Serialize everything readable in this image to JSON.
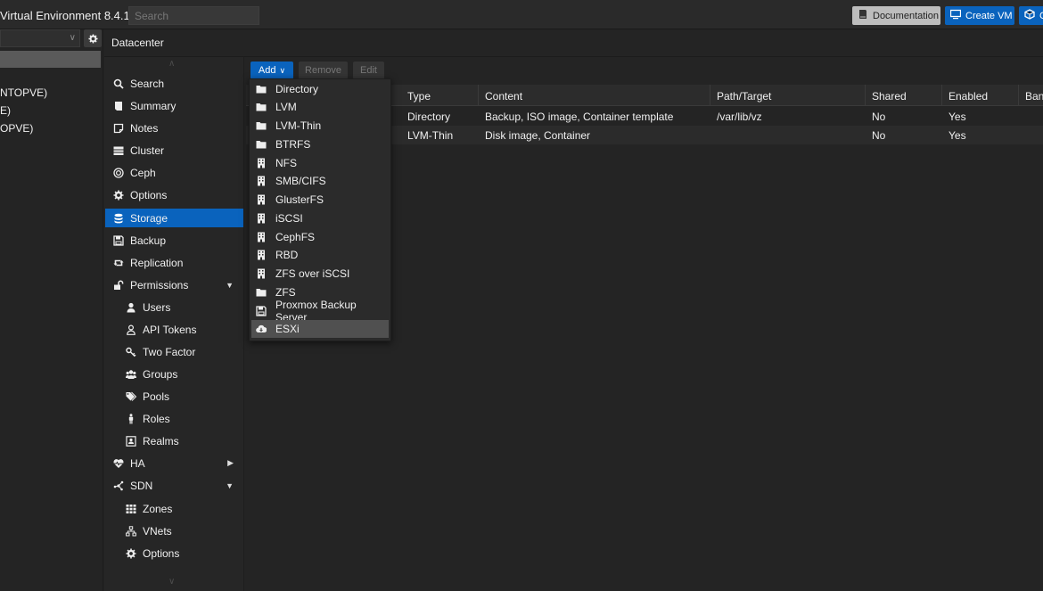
{
  "app": {
    "title": "Virtual Environment 8.4.1",
    "search_placeholder": "Search",
    "documentation_label": "Documentation",
    "create_vm_label": "Create VM",
    "create_ct_label": "C"
  },
  "tree": {
    "items": [
      "NTOPVE)",
      "E)",
      "OPVE)"
    ]
  },
  "breadcrumb": "Datacenter",
  "nav": [
    {
      "label": "Search",
      "icon": "search-icon"
    },
    {
      "label": "Summary",
      "icon": "book-icon"
    },
    {
      "label": "Notes",
      "icon": "note-icon"
    },
    {
      "label": "Cluster",
      "icon": "server-icon"
    },
    {
      "label": "Ceph",
      "icon": "ceph-icon"
    },
    {
      "label": "Options",
      "icon": "gear-icon"
    },
    {
      "label": "Storage",
      "icon": "database-icon"
    },
    {
      "label": "Backup",
      "icon": "floppy-icon"
    },
    {
      "label": "Replication",
      "icon": "retweet-icon"
    },
    {
      "label": "Permissions",
      "icon": "unlock-icon"
    },
    {
      "label": "Users",
      "icon": "user-icon"
    },
    {
      "label": "API Tokens",
      "icon": "user-outline-icon"
    },
    {
      "label": "Two Factor",
      "icon": "key-icon"
    },
    {
      "label": "Groups",
      "icon": "users-icon"
    },
    {
      "label": "Pools",
      "icon": "tags-icon"
    },
    {
      "label": "Roles",
      "icon": "male-icon"
    },
    {
      "label": "Realms",
      "icon": "address-book-icon"
    },
    {
      "label": "HA",
      "icon": "heartbeat-icon"
    },
    {
      "label": "SDN",
      "icon": "sdn-icon"
    },
    {
      "label": "Zones",
      "icon": "th-icon"
    },
    {
      "label": "VNets",
      "icon": "network-icon"
    },
    {
      "label": "Options",
      "icon": "gear-icon"
    }
  ],
  "toolbar": {
    "add_label": "Add",
    "remove_label": "Remove",
    "edit_label": "Edit"
  },
  "grid": {
    "columns": [
      "Type",
      "Content",
      "Path/Target",
      "Shared",
      "Enabled",
      "Ban"
    ],
    "rows": [
      {
        "type": "Directory",
        "content": "Backup, ISO image, Container template",
        "path": "/var/lib/vz",
        "shared": "No",
        "enabled": "Yes"
      },
      {
        "type": "LVM-Thin",
        "content": "Disk image, Container",
        "path": "",
        "shared": "No",
        "enabled": "Yes"
      }
    ]
  },
  "menu": [
    {
      "label": "Directory",
      "icon": "folder-icon"
    },
    {
      "label": "LVM",
      "icon": "folder-icon"
    },
    {
      "label": "LVM-Thin",
      "icon": "folder-icon"
    },
    {
      "label": "BTRFS",
      "icon": "folder-icon"
    },
    {
      "label": "NFS",
      "icon": "building-icon"
    },
    {
      "label": "SMB/CIFS",
      "icon": "building-icon"
    },
    {
      "label": "GlusterFS",
      "icon": "building-icon"
    },
    {
      "label": "iSCSI",
      "icon": "building-icon"
    },
    {
      "label": "CephFS",
      "icon": "building-icon"
    },
    {
      "label": "RBD",
      "icon": "building-icon"
    },
    {
      "label": "ZFS over iSCSI",
      "icon": "building-icon"
    },
    {
      "label": "ZFS",
      "icon": "folder-icon"
    },
    {
      "label": "Proxmox Backup Server",
      "icon": "floppy-icon"
    },
    {
      "label": "ESXi",
      "icon": "cloud-download-icon"
    }
  ],
  "colors": {
    "accent": "#0a63bd",
    "background": "#242424",
    "menu_highlight": "#505050"
  }
}
